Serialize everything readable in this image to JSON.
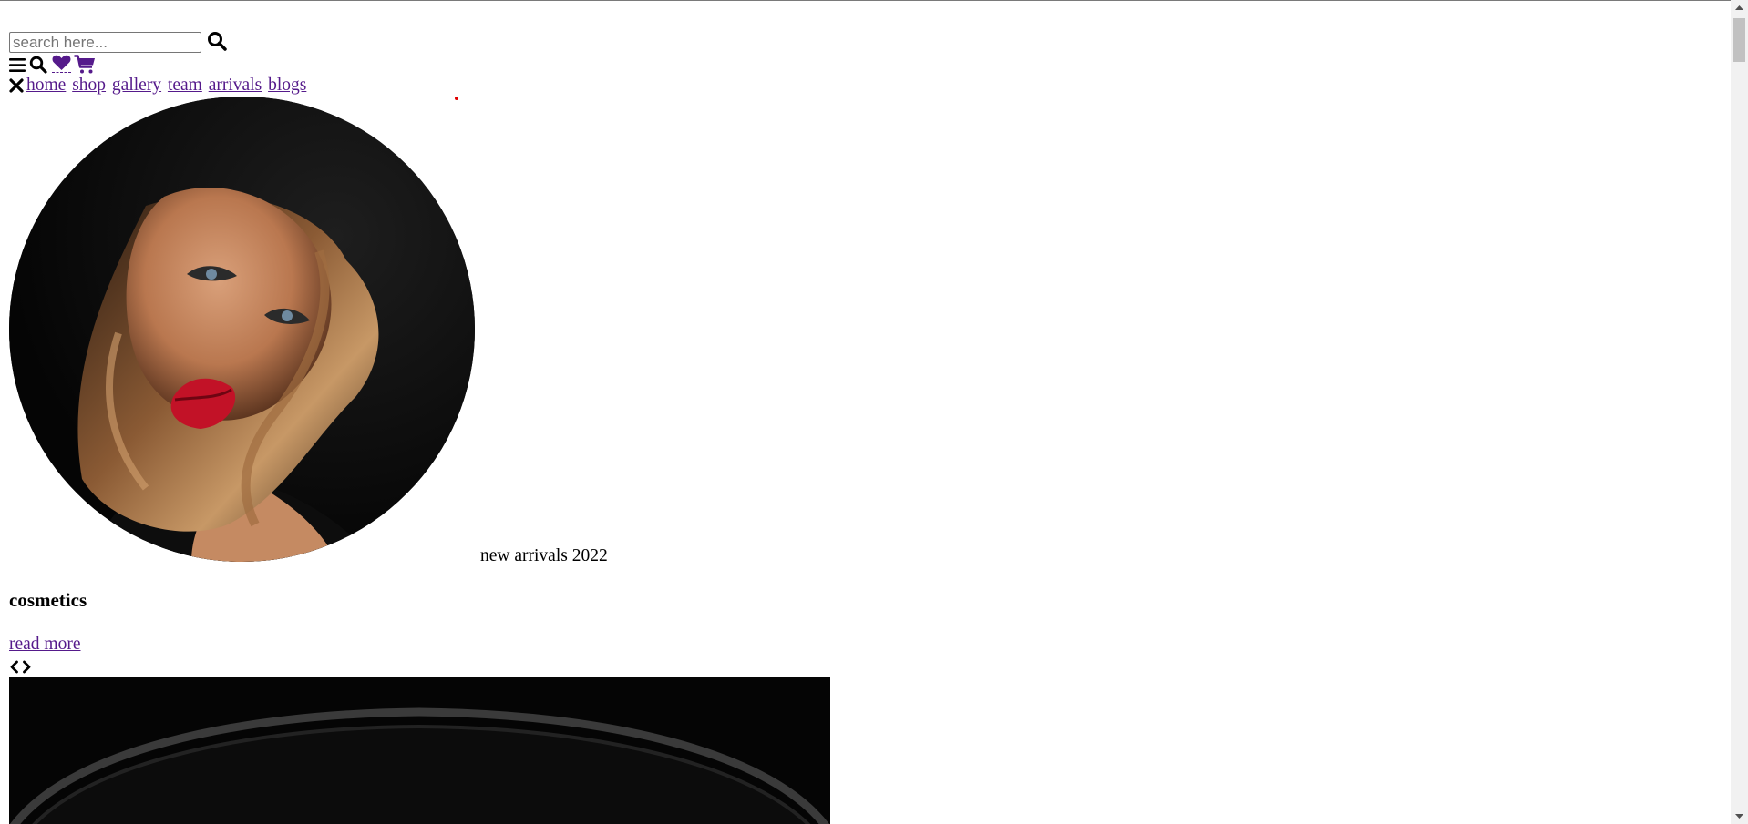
{
  "search": {
    "placeholder": "search here...",
    "value": ""
  },
  "icons": {
    "search_submit": "search-icon",
    "menu": "bars-icon",
    "search_toggle": "search-icon",
    "wishlist": "heart-icon",
    "cart": "cart-icon",
    "close": "close-icon",
    "prev": "chevron-left-icon",
    "next": "chevron-right-icon"
  },
  "nav": {
    "items": [
      {
        "label": "home"
      },
      {
        "label": "shop"
      },
      {
        "label": "gallery"
      },
      {
        "label": "team"
      },
      {
        "label": "arrivals"
      },
      {
        "label": "blogs"
      }
    ]
  },
  "hero": {
    "caption": "new arrivals 2022",
    "title": "cosmetics",
    "cta_label": "read more"
  },
  "colors": {
    "link": "#551a8b",
    "accent_dot": "#e00000",
    "text": "#000000",
    "background": "#ffffff"
  }
}
